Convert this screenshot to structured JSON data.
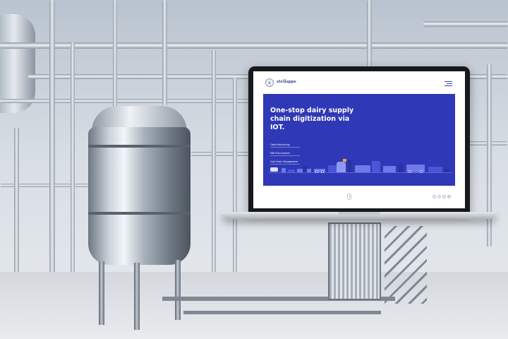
{
  "site": {
    "logo_text": "stellapps",
    "logo_tagline": "",
    "menu_icon": "hamburger-menu-icon"
  },
  "hero": {
    "title": "One-stop dairy supply chain digitization via IOT.",
    "subtitle": "",
    "links": [
      "Cattle Monitoring",
      "Milk Procurement",
      "Cold Chain Management"
    ],
    "background_color": "#2f38b6"
  },
  "footer": {
    "scroll_icon": "mouse-scroll-icon",
    "social_icons": [
      "facebook-icon",
      "twitter-icon",
      "linkedin-icon",
      "youtube-icon"
    ]
  },
  "colors": {
    "brand_blue": "#2f38b6",
    "accent_orange": "#f0a43a"
  }
}
